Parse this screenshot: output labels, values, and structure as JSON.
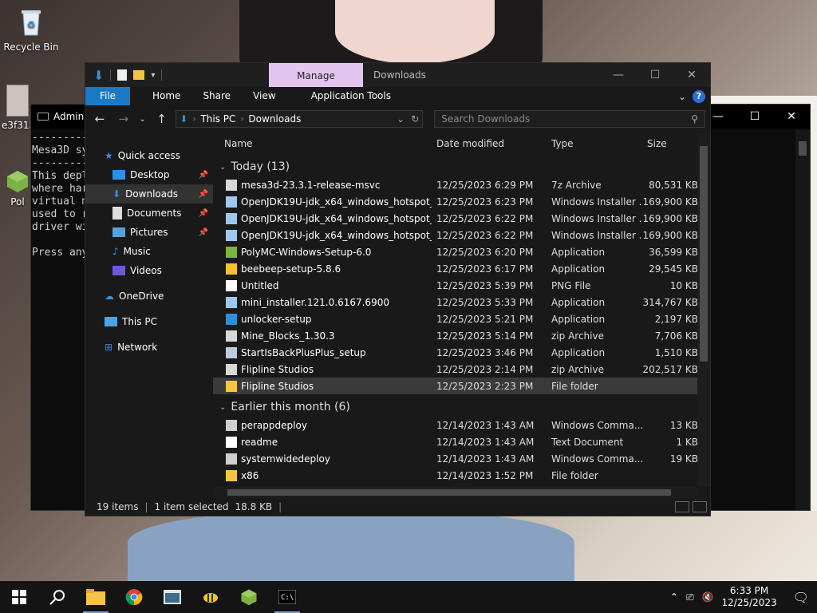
{
  "desktop": {
    "recycle_bin": "Recycle Bin",
    "icon2": "e3f315",
    "icon3": "Pol"
  },
  "cmd": {
    "title": "Admini",
    "lines": [
      "---------",
      "Mesa3D sy",
      "---------",
      "This depl",
      "where har",
      "virtual m",
      "used to r",
      "driver wi",
      "",
      "Press any"
    ]
  },
  "explorer": {
    "manage_tab": "Manage",
    "title": "Downloads",
    "ribbon_tabs": [
      "File",
      "Home",
      "Share",
      "View",
      "Application Tools"
    ],
    "breadcrumb": [
      "This PC",
      "Downloads"
    ],
    "search_placeholder": "Search Downloads",
    "nav": [
      {
        "label": "Quick access",
        "icon": "star-icon"
      },
      {
        "label": "Desktop",
        "icon": "desktop-icon",
        "pinned": true
      },
      {
        "label": "Downloads",
        "icon": "download-icon",
        "pinned": true,
        "selected": true
      },
      {
        "label": "Documents",
        "icon": "document-icon",
        "pinned": true
      },
      {
        "label": "Pictures",
        "icon": "picture-icon",
        "pinned": true
      },
      {
        "label": "Music",
        "icon": "music-icon"
      },
      {
        "label": "Videos",
        "icon": "video-icon"
      },
      {
        "label": "OneDrive",
        "icon": "cloud-icon"
      },
      {
        "label": "This PC",
        "icon": "computer-icon"
      },
      {
        "label": "Network",
        "icon": "network-icon"
      }
    ],
    "columns": [
      "Name",
      "Date modified",
      "Type",
      "Size"
    ],
    "groups": [
      {
        "label": "Today (13)",
        "files": [
          {
            "name": "mesa3d-23.3.1-release-msvc",
            "date": "12/25/2023 6:29 PM",
            "type": "7z Archive",
            "size": "80,531 KB",
            "icon": "archive-icon"
          },
          {
            "name": "OpenJDK19U-jdk_x64_windows_hotspot_...",
            "date": "12/25/2023 6:23 PM",
            "type": "Windows Installer ...",
            "size": "169,900 KB",
            "icon": "installer-icon"
          },
          {
            "name": "OpenJDK19U-jdk_x64_windows_hotspot_...",
            "date": "12/25/2023 6:22 PM",
            "type": "Windows Installer ...",
            "size": "169,900 KB",
            "icon": "installer-icon"
          },
          {
            "name": "OpenJDK19U-jdk_x64_windows_hotspot_...",
            "date": "12/25/2023 6:22 PM",
            "type": "Windows Installer ...",
            "size": "169,900 KB",
            "icon": "installer-icon"
          },
          {
            "name": "PolyMC-Windows-Setup-6.0",
            "date": "12/25/2023 6:20 PM",
            "type": "Application",
            "size": "36,599 KB",
            "icon": "polymc-icon"
          },
          {
            "name": "beebeep-setup-5.8.6",
            "date": "12/25/2023 6:17 PM",
            "type": "Application",
            "size": "29,545 KB",
            "icon": "bee-icon"
          },
          {
            "name": "Untitled",
            "date": "12/25/2023 5:39 PM",
            "type": "PNG File",
            "size": "10 KB",
            "icon": "image-file-icon"
          },
          {
            "name": "mini_installer.121.0.6167.6900",
            "date": "12/25/2023 5:33 PM",
            "type": "Application",
            "size": "314,767 KB",
            "icon": "installer-icon"
          },
          {
            "name": "unlocker-setup",
            "date": "12/25/2023 5:21 PM",
            "type": "Application",
            "size": "2,197 KB",
            "icon": "unlocker-icon"
          },
          {
            "name": "Mine_Blocks_1.30.3",
            "date": "12/25/2023 5:14 PM",
            "type": "zip Archive",
            "size": "7,706 KB",
            "icon": "archive-icon"
          },
          {
            "name": "StartIsBackPlusPlus_setup",
            "date": "12/25/2023 3:46 PM",
            "type": "Application",
            "size": "1,510 KB",
            "icon": "app-icon"
          },
          {
            "name": "Flipline Studios",
            "date": "12/25/2023 2:14 PM",
            "type": "zip Archive",
            "size": "202,517 KB",
            "icon": "archive-icon"
          },
          {
            "name": "Flipline Studios",
            "date": "12/25/2023 2:23 PM",
            "type": "File folder",
            "size": "",
            "icon": "folder-icon",
            "selected": true
          }
        ]
      },
      {
        "label": "Earlier this month (6)",
        "files": [
          {
            "name": "perappdeploy",
            "date": "12/14/2023 1:43 AM",
            "type": "Windows Comma...",
            "size": "13 KB",
            "icon": "cmd-file-icon"
          },
          {
            "name": "readme",
            "date": "12/14/2023 1:43 AM",
            "type": "Text Document",
            "size": "1 KB",
            "icon": "text-file-icon"
          },
          {
            "name": "systemwidedeploy",
            "date": "12/14/2023 1:43 AM",
            "type": "Windows Comma...",
            "size": "19 KB",
            "icon": "cmd-file-icon"
          },
          {
            "name": "x86",
            "date": "12/14/2023 1:52 PM",
            "type": "File folder",
            "size": "",
            "icon": "folder-icon"
          }
        ]
      }
    ],
    "status": {
      "items": "19 items",
      "selected": "1 item selected",
      "size": "18.8 KB"
    }
  },
  "taskbar": {
    "time": "6:33 PM",
    "date": "12/25/2023"
  }
}
